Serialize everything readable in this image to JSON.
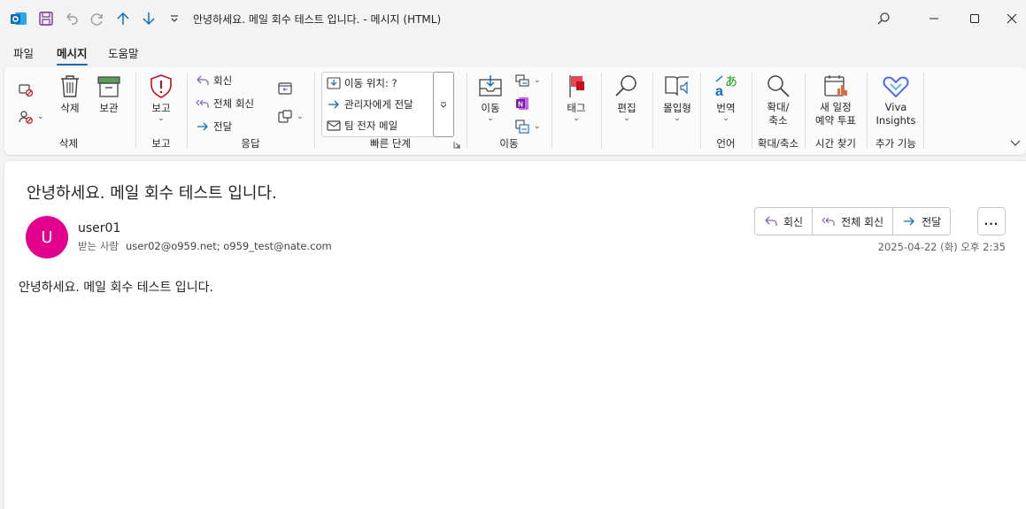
{
  "window": {
    "title": "안녕하세요. 메일 회수 테스트 입니다.  -  메시지 (HTML)",
    "icons": [
      "outlook-icon",
      "save-icon",
      "undo-icon",
      "redo-icon",
      "up-icon",
      "down-icon",
      "customize-icon"
    ],
    "controls": [
      "search-icon",
      "minimize-icon",
      "maximize-icon",
      "close-icon"
    ]
  },
  "menu": {
    "tabs": [
      {
        "label": "파일",
        "active": false
      },
      {
        "label": "메시지",
        "active": true
      },
      {
        "label": "도움말",
        "active": false
      }
    ]
  },
  "ribbon": {
    "delete_group": {
      "label": "삭제",
      "delete": "삭제",
      "archive": "보관"
    },
    "report_group": {
      "label": "보고",
      "report": "보고"
    },
    "respond_group": {
      "label": "응답",
      "reply": "회신",
      "reply_all": "전체 회신",
      "forward": "전달"
    },
    "quicksteps_group": {
      "label": "빠른 단계",
      "items": [
        "이동 위치: ?",
        "관리자에게 전달",
        "팀 전자 메일"
      ]
    },
    "move_group": {
      "label": "이동",
      "move": "이동"
    },
    "tags_group": {
      "label": "",
      "tags": "태그"
    },
    "editing_group": {
      "label": "",
      "editing": "편집"
    },
    "immersive_group": {
      "label": "",
      "immersive": "몰입형"
    },
    "language_group": {
      "label": "언어",
      "translate": "번역"
    },
    "zoom_group": {
      "label": "확대/축소",
      "zoom_line1": "확대/",
      "zoom_line2": "축소"
    },
    "findtime_group": {
      "label": "시간 찾기",
      "poll_line1": "새 일정",
      "poll_line2": "예약 투표"
    },
    "addins_group": {
      "label": "추가 기능",
      "viva_line1": "Viva",
      "viva_line2": "Insights"
    }
  },
  "message": {
    "subject": "안녕하세요. 메일 회수 테스트 입니다.",
    "avatar_initial": "U",
    "sender": "user01",
    "to_label": "받는 사람",
    "to": "user02@o959.net; o959_test@nate.com",
    "actions": {
      "reply": "회신",
      "reply_all": "전체 회신",
      "forward": "전달",
      "more": "..."
    },
    "datetime": "2025-04-22 (화) 오후 2:35",
    "body": "안녕하세요. 메일 회수 테스트 입니다."
  },
  "colors": {
    "accent": "#0f6cbd",
    "avatar": "#e3008c",
    "reply_purple": "#8764b8",
    "flag_red": "#c50f1f",
    "outlook_blue": "#0f6cbd"
  }
}
